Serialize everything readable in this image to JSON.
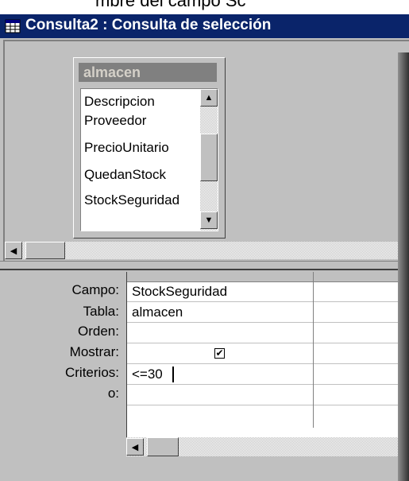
{
  "top_caption": "mbre del campo Sc",
  "window": {
    "title": "Consulta2 : Consulta de selección",
    "title_icon": "query-grid-icon"
  },
  "table_box": {
    "name": "almacen",
    "fields": [
      "Descripcion",
      "Proveedor",
      "PrecioUnitario",
      "QuedanStock",
      "StockSeguridad"
    ]
  },
  "grid": {
    "row_labels": {
      "campo": "Campo:",
      "tabla": "Tabla:",
      "orden": "Orden:",
      "mostrar": "Mostrar:",
      "criterios": "Criterios:",
      "o": "o:"
    },
    "columns": [
      {
        "campo": "StockSeguridad",
        "tabla": "almacen",
        "orden": "",
        "mostrar": true,
        "criterios": "<=30",
        "o": ""
      },
      {
        "campo": "",
        "tabla": "",
        "orden": "",
        "mostrar": false,
        "criterios": "",
        "o": ""
      }
    ]
  },
  "icons": {
    "scroll_up": "▲",
    "scroll_down": "▼",
    "scroll_left": "◀",
    "check": "✔"
  },
  "colors": {
    "titlebar": "#0a246a",
    "face": "#c0c0c0"
  }
}
